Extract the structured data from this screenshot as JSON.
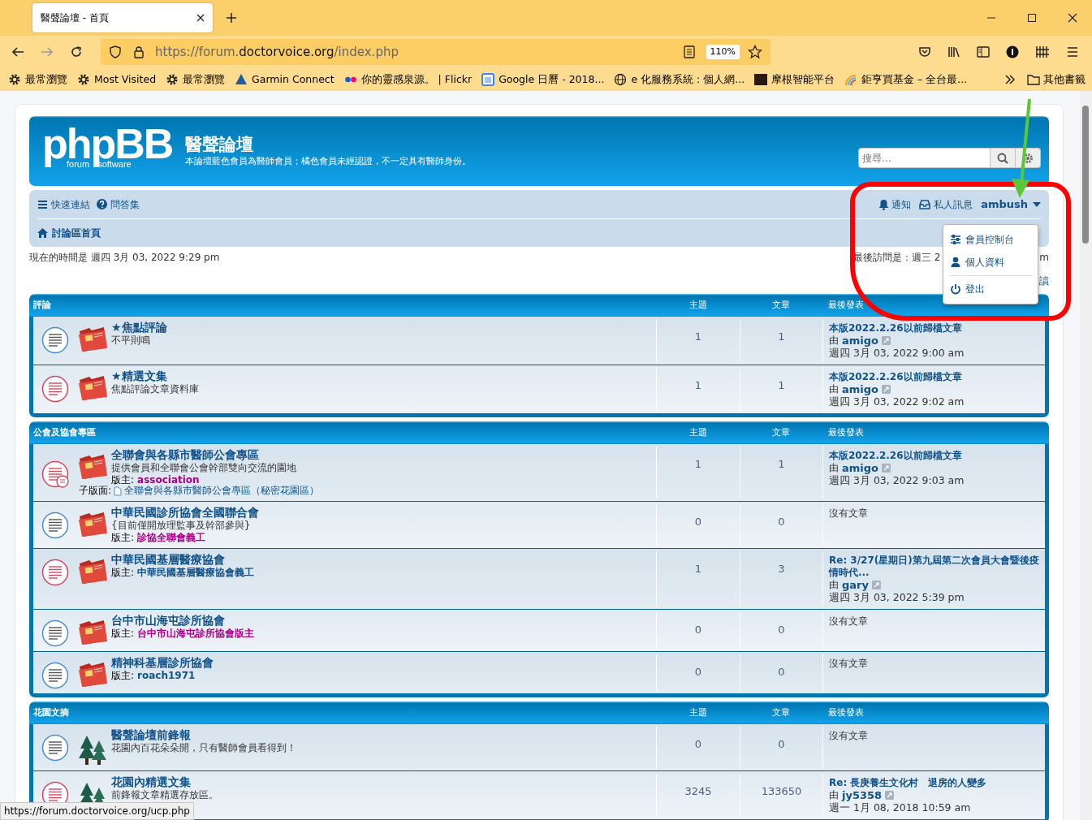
{
  "browser": {
    "tabs": [
      {
        "title": "醫聲論壇 - 首頁",
        "selected": true
      }
    ],
    "forward_disabled": true,
    "url": {
      "prefix": "https://forum.",
      "domain": "doctorvoice.org",
      "path": "/index.php"
    },
    "zoom": "110%",
    "bookmarks": [
      {
        "label": "最常瀏覽",
        "kind": "gear"
      },
      {
        "label": "Most Visited",
        "kind": "gear"
      },
      {
        "label": "最常瀏覽",
        "kind": "gear"
      },
      {
        "label": "Garmin Connect",
        "kind": "triangle"
      },
      {
        "label": "你的靈感泉源。 | Flickr",
        "kind": "dots"
      },
      {
        "label": "Google 日曆 - 2018...",
        "kind": "calendar"
      },
      {
        "label": "e 化服務系統 : 個人網...",
        "kind": "globe"
      },
      {
        "label": "摩根智能平台",
        "kind": "square"
      },
      {
        "label": "鉅亨買基金 – 全台最...",
        "kind": "arc"
      }
    ],
    "other_bookmarks": "其他書籤",
    "status_url": "https://forum.doctorvoice.org/ucp.php"
  },
  "header": {
    "logo": {
      "name": "phpBB",
      "left": "forum",
      "right": "software"
    },
    "site_title": "醫聲論壇",
    "site_description": "本論壇藍色會員為醫師會員；橘色會員未經認證，不一定具有醫師身份。",
    "search": {
      "placeholder": "搜尋…"
    }
  },
  "nav": {
    "quick_links": "快速連結",
    "faq": "問答集",
    "notifications": "通知",
    "messages": "私人訊息",
    "username": "ambush",
    "breadcrumb": "討論區首頁"
  },
  "user_menu": [
    {
      "label": "會員控制台",
      "kind": "sliders"
    },
    {
      "label": "個人資料",
      "kind": "user"
    },
    {
      "label": "登出",
      "kind": "power"
    }
  ],
  "current_time": "現在的時間是 週四 3月 03, 2022 9:29 pm",
  "last_visit_visible": "最後訪問是：週三 2",
  "last_visit_tail": "m",
  "mark_read_visible": "讀",
  "categories": [
    {
      "title": "評論",
      "col_topics": "主題",
      "col_posts": "文章",
      "col_last": "最後發表",
      "forums": [
        {
          "kind": "folder",
          "unread": false,
          "title": "★焦點評論",
          "description": "不平則鳴",
          "topics": "1",
          "posts": "1",
          "last_post": {
            "title": "本版2022.2.26以前歸檔文章",
            "by": "由",
            "author": "amigo",
            "time": "週四 3月 03, 2022 9:00 am"
          }
        },
        {
          "kind": "folder",
          "unread": true,
          "title": "★精選文集",
          "description": "焦點評論文章資料庫",
          "topics": "1",
          "posts": "1",
          "last_post": {
            "title": "本版2022.2.26以前歸檔文章",
            "by": "由",
            "author": "amigo",
            "time": "週四 3月 03, 2022 9:02 am"
          }
        }
      ]
    },
    {
      "title": "公會及協會專區",
      "col_topics": "主題",
      "col_posts": "文章",
      "col_last": "最後發表",
      "forums": [
        {
          "kind": "folder",
          "unread": true,
          "title": "全聯會與各縣市醫師公會專區",
          "description": "提供會員和全聯會公會幹部雙向交流的園地",
          "moderator_label": "版主:",
          "moderators": [
            {
              "name": "association",
              "color": "#aa0088"
            }
          ],
          "subforum_label": "子版面:",
          "subforums": [
            "全聯會與各縣市醫師公會專區（秘密花園區）"
          ],
          "topics": "1",
          "posts": "1",
          "last_post": {
            "title": "本版2022.2.26以前歸檔文章",
            "by": "由",
            "author": "amigo",
            "time": "週四 3月 03, 2022 9:03 am"
          }
        },
        {
          "kind": "folder",
          "unread": false,
          "title": "中華民國診所協會全國聯合會",
          "description": "{目前僅開放理監事及幹部參與}",
          "moderator_label": "版主:",
          "moderators": [
            {
              "name": "診協全聯會義工",
              "color": "#aa0088"
            }
          ],
          "topics": "0",
          "posts": "0",
          "no_posts": "沒有文章"
        },
        {
          "kind": "folder",
          "unread": true,
          "title": "中華民國基層醫療協會",
          "moderator_label": "版主:",
          "moderators": [
            {
              "name": "中華民國基層醫療協會義工",
              "color": "#105289"
            }
          ],
          "topics": "1",
          "posts": "3",
          "last_post": {
            "title": "Re: 3/27(星期日)第九屆第二次會員大會暨後疫情時代...",
            "by": "由",
            "author": "gary",
            "time": "週四 3月 03, 2022 5:39 pm"
          }
        },
        {
          "kind": "folder",
          "unread": false,
          "title": "台中市山海屯診所協會",
          "moderator_label": "版主:",
          "moderators": [
            {
              "name": "台中市山海屯診所協會版主",
              "color": "#aa0088"
            }
          ],
          "topics": "0",
          "posts": "0",
          "no_posts": "沒有文章"
        },
        {
          "kind": "folder",
          "unread": false,
          "title": "精神科基層診所協會",
          "moderator_label": "版主:",
          "moderators": [
            {
              "name": "roach1971",
              "color": "#105289"
            }
          ],
          "topics": "0",
          "posts": "0",
          "no_posts": "沒有文章"
        }
      ]
    },
    {
      "title": "花園文摘",
      "col_topics": "主題",
      "col_posts": "文章",
      "col_last": "最後發表",
      "forums": [
        {
          "kind": "trees",
          "unread": false,
          "title": "醫聲論壇前鋒報",
          "description": "花園內百花朵朵開，只有醫師會員看得到！",
          "topics": "0",
          "posts": "0",
          "no_posts": "沒有文章"
        },
        {
          "kind": "trees",
          "unread": true,
          "title": "花園內精選文集",
          "description": "前鋒報文章精選存放區。",
          "topics": "3245",
          "posts": "133650",
          "last_post": {
            "title": "Re: 長庚養生文化村　退房的人變多",
            "by": "由",
            "author": "jy5358",
            "time": "週一 1月 08, 2018 10:59 am"
          }
        }
      ]
    }
  ]
}
